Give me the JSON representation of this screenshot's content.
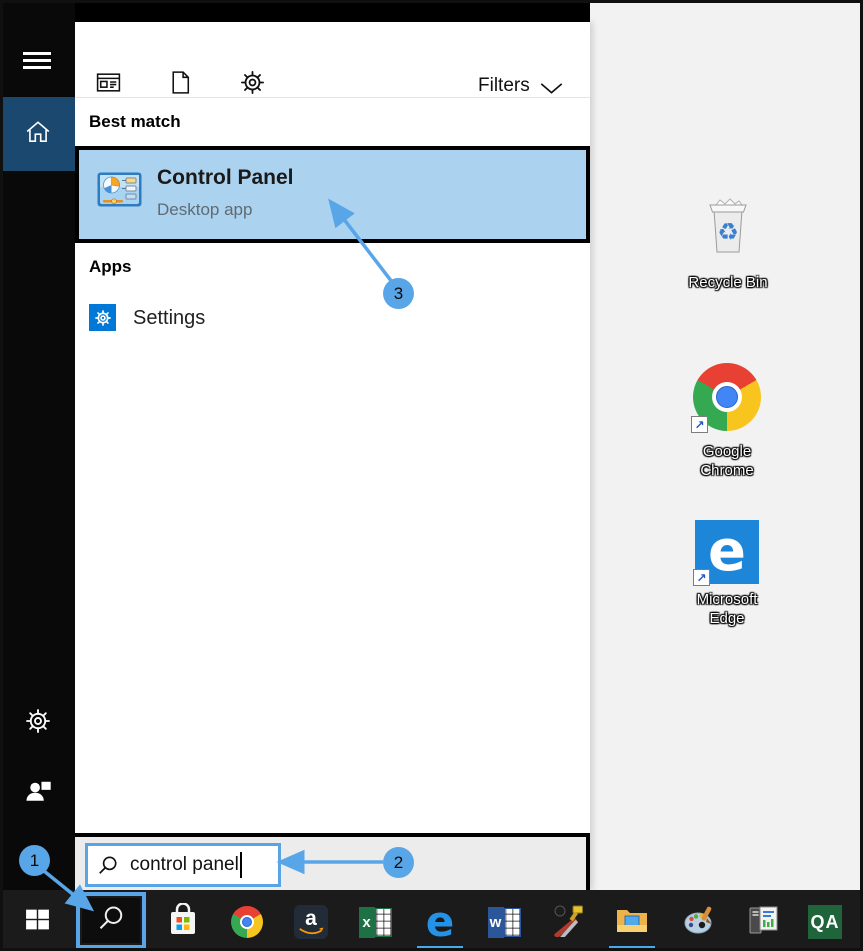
{
  "flyout": {
    "toolbar": {
      "filters_label": "Filters"
    },
    "best_match": {
      "header": "Best match",
      "result_title": "Control Panel",
      "result_subtitle": "Desktop app"
    },
    "apps": {
      "header": "Apps",
      "settings_label": "Settings"
    },
    "search_box": {
      "value": "control panel"
    }
  },
  "desktop": {
    "icons": [
      {
        "label": "Recycle Bin"
      },
      {
        "label": "Google Chrome"
      },
      {
        "label": "Microsoft Edge"
      }
    ]
  },
  "taskbar": {
    "glyphs": {
      "amazon": "a",
      "excel": "x",
      "edge": "e",
      "word": "w",
      "qa": "QA",
      "edge_desktop": "e"
    }
  },
  "icons": {
    "shortcut_arrow": "↗",
    "recycle_glyph": "♻"
  },
  "callouts": {
    "step1": "1",
    "step2": "2",
    "step3": "3"
  },
  "colors": {
    "annotation_blue": "#58a6e8",
    "selection_blue": "#abd2ef",
    "home_accent": "#1b486f",
    "settings_tile_blue": "#0078d7"
  }
}
